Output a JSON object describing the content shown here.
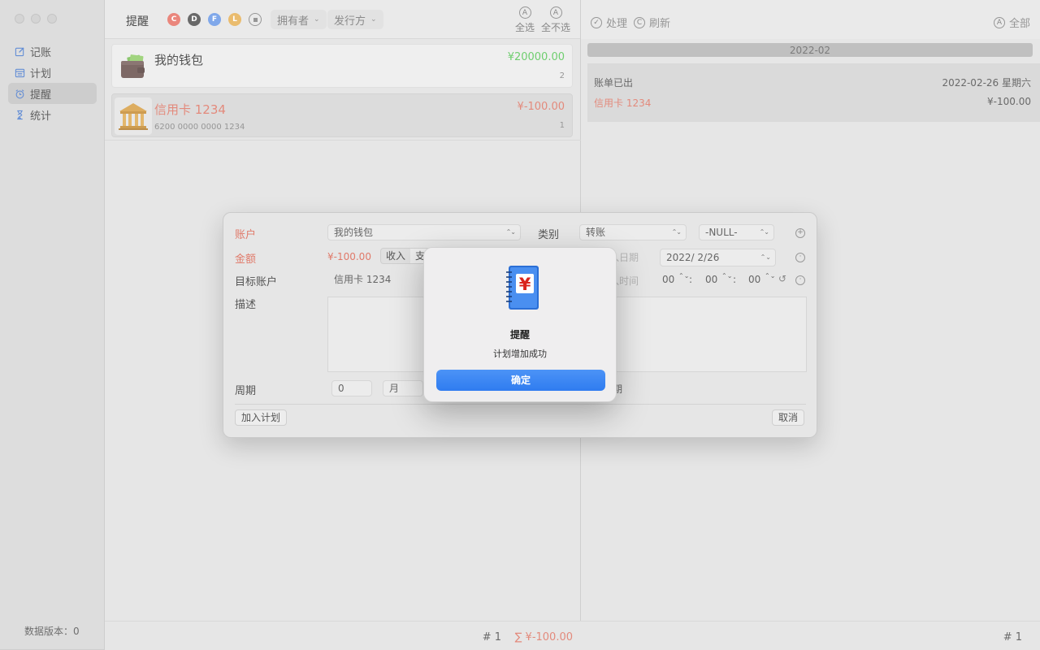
{
  "sidebar": {
    "nav": [
      {
        "label": "记账",
        "icon": "edit-icon"
      },
      {
        "label": "计划",
        "icon": "calendar-icon"
      },
      {
        "label": "提醒",
        "icon": "alarm-clock-icon"
      },
      {
        "label": "统计",
        "icon": "hourglass-icon"
      }
    ],
    "active_index": 2,
    "footer": "数据版本：0"
  },
  "middle": {
    "title": "提醒",
    "filters": [
      {
        "letter": "C",
        "color": "#e8766a"
      },
      {
        "letter": "D",
        "color": "#555555"
      },
      {
        "letter": "F",
        "color": "#6f9de8"
      },
      {
        "letter": "L",
        "color": "#e8b35a"
      }
    ],
    "owner_select": "拥有者",
    "issuer_select": "发行方",
    "select_all": {
      "icon_letter": "A",
      "label": "全选"
    },
    "select_none": {
      "icon_letter": "A",
      "label": "全不选"
    },
    "cards": [
      {
        "name": "我的钱包",
        "amount": "¥20000.00",
        "amount_color": "#5cc85c",
        "sub": "",
        "count": "2",
        "icon": "wallet-icon"
      },
      {
        "name": "信用卡 1234",
        "amount": "¥-100.00",
        "amount_color": "#e07a6a",
        "sub": "6200 0000 0000 1234",
        "count": "1",
        "icon": "bank-icon"
      }
    ],
    "footer_count": "#  1",
    "footer_sum": "∑  ¥-100.00"
  },
  "right": {
    "process": {
      "icon_letter": "✓",
      "label": "处理"
    },
    "refresh": {
      "icon_letter": "C",
      "label": "刷新"
    },
    "all": {
      "icon_letter": "A",
      "label": "全部"
    },
    "month": "2022-02",
    "bill": {
      "status": "账单已出",
      "date": "2022-02-26 星期六",
      "account": "信用卡 1234",
      "amount": "¥-100.00"
    },
    "footer_count": "#  1"
  },
  "form": {
    "account_label": "账户",
    "account_value": "我的钱包",
    "category_label": "类别",
    "category_value": "转账",
    "subcategory_value": "-NULL-",
    "amount_label": "金额",
    "amount_value": "¥-100.00",
    "income_tab": "收入",
    "expense_tab": "支",
    "date_label": "入日期",
    "date_value": "2022/  2/26",
    "target_label": "目标账户",
    "target_value": "信用卡 1234",
    "time_label": "入时间",
    "hour": "00",
    "minute": "00",
    "second": "00",
    "desc_label": "描述",
    "period_label": "周期",
    "period_value": "0",
    "period_unit": "月",
    "period_right": "期",
    "add_plan": "加入计划",
    "cancel": "取消"
  },
  "alert": {
    "title": "提醒",
    "message": "计划增加成功",
    "ok": "确定"
  }
}
